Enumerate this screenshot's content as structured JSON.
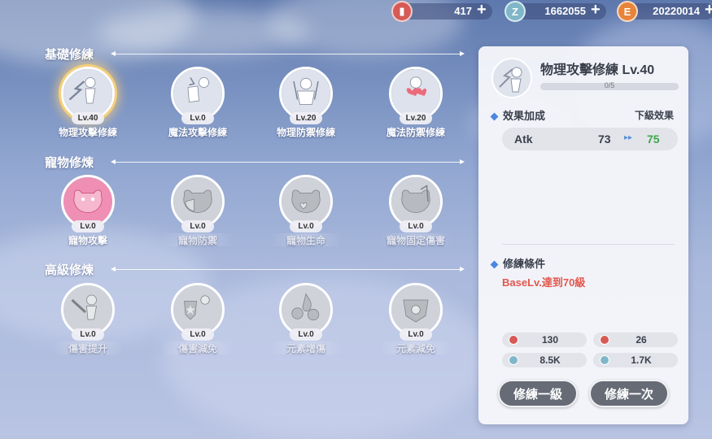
{
  "currencies": [
    {
      "name": "ticket-icon",
      "value": "417",
      "color": "#d65a55",
      "glyph": "▮"
    },
    {
      "name": "zeny-coin-icon",
      "value": "1662055",
      "color": "#7fb7c9",
      "glyph": "Z"
    },
    {
      "name": "exp-coin-icon",
      "value": "20220014",
      "color": "#e8843a",
      "glyph": "E"
    }
  ],
  "sections": [
    {
      "title": "基礎修練",
      "skills": [
        {
          "name": "物理攻擊修練",
          "level": "Lv.40",
          "selected": true,
          "locked": false
        },
        {
          "name": "魔法攻擊修練",
          "level": "Lv.0",
          "selected": false,
          "locked": false
        },
        {
          "name": "物理防禦修練",
          "level": "Lv.20",
          "selected": false,
          "locked": false
        },
        {
          "name": "魔法防禦修練",
          "level": "Lv.20",
          "selected": false,
          "locked": false
        }
      ]
    },
    {
      "title": "寵物修煉",
      "skills": [
        {
          "name": "寵物攻擊",
          "level": "Lv.0",
          "selected": false,
          "locked": false
        },
        {
          "name": "寵物防禦",
          "level": "Lv.0",
          "selected": false,
          "locked": true
        },
        {
          "name": "寵物生命",
          "level": "Lv.0",
          "selected": false,
          "locked": true
        },
        {
          "name": "寵物固定傷害",
          "level": "Lv.0",
          "selected": false,
          "locked": true
        }
      ]
    },
    {
      "title": "高級修煉",
      "skills": [
        {
          "name": "傷害提升",
          "level": "Lv.0",
          "selected": false,
          "locked": true
        },
        {
          "name": "傷害減免",
          "level": "Lv.0",
          "selected": false,
          "locked": true
        },
        {
          "name": "元素增傷",
          "level": "Lv.0",
          "selected": false,
          "locked": true
        },
        {
          "name": "元素減免",
          "level": "Lv.0",
          "selected": false,
          "locked": true
        }
      ]
    }
  ],
  "detail": {
    "title": "物理攻擊修練 Lv.40",
    "progress_text": "0/5",
    "progress_fraction": 0,
    "effect_label": "效果加成",
    "next_label": "下級效果",
    "stat": {
      "name": "Atk",
      "current": "73",
      "arrow": "▸▸",
      "next": "75"
    },
    "requirement_label": "修練條件",
    "requirement_text": "BaseLv.達到70級",
    "costs": [
      {
        "value": "130",
        "icon": "ticket-icon",
        "color": "#d65a55"
      },
      {
        "value": "26",
        "icon": "ticket-icon",
        "color": "#d65a55"
      },
      {
        "value": "8.5K",
        "icon": "zeny-coin-icon",
        "color": "#7fb7c9"
      },
      {
        "value": "1.7K",
        "icon": "zeny-coin-icon",
        "color": "#7fb7c9"
      }
    ],
    "btn_train_one_level": "修練一級",
    "btn_train_once": "修練一次"
  },
  "plus_symbol": "+"
}
